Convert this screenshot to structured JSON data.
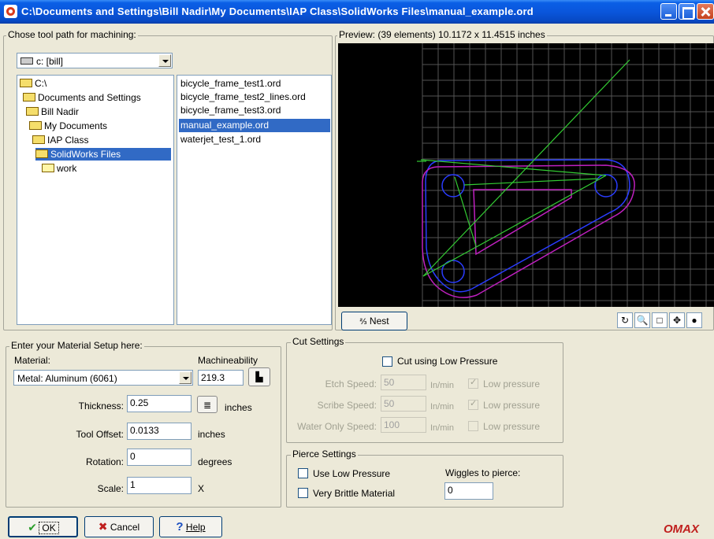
{
  "window": {
    "title": "C:\\Documents and Settings\\Bill Nadir\\My Documents\\IAP Class\\SolidWorks Files\\manual_example.ord"
  },
  "toolpath": {
    "group_label": "Chose tool path for machining:",
    "drive_value": "c: [bill]",
    "folders": [
      {
        "label": "C:\\",
        "open": true,
        "selected": false
      },
      {
        "label": "Documents and Settings",
        "open": true,
        "selected": false
      },
      {
        "label": "Bill Nadir",
        "open": true,
        "selected": false
      },
      {
        "label": "My Documents",
        "open": true,
        "selected": false
      },
      {
        "label": "IAP Class",
        "open": true,
        "selected": false
      },
      {
        "label": "SolidWorks Files",
        "open": true,
        "selected": true
      },
      {
        "label": "work",
        "open": false,
        "selected": false
      }
    ],
    "files": [
      {
        "label": "bicycle_frame_test1.ord",
        "selected": false
      },
      {
        "label": "bicycle_frame_test2_lines.ord",
        "selected": false
      },
      {
        "label": "bicycle_frame_test3.ord",
        "selected": false
      },
      {
        "label": "manual_example.ord",
        "selected": true
      },
      {
        "label": "waterjet_test_1.ord",
        "selected": false
      }
    ]
  },
  "preview": {
    "label": "Preview: (39 elements) 10.1172 x 11.4515 inches",
    "nest_label": "Nest",
    "colors": {
      "background": "#000000",
      "grid": "#555555",
      "part_outline": "#2a3cff",
      "cut_path": "#c020c0",
      "lead_lines": "#33cc33"
    },
    "tools": [
      "rotate-icon",
      "zoom-icon",
      "select-box-icon",
      "pan-icon",
      "globe-icon"
    ]
  },
  "material": {
    "group_label": "Enter your Material Setup here:",
    "material_label": "Material:",
    "material_value": "Metal: Aluminum (6061)",
    "machineability_label": "Machineability",
    "machineability_value": "219.3",
    "thickness_label": "Thickness:",
    "thickness_value": "0.25",
    "thickness_units": "inches",
    "tool_offset_label": "Tool Offset:",
    "tool_offset_value": "0.0133",
    "tool_offset_units": "inches",
    "rotation_label": "Rotation:",
    "rotation_value": "0",
    "rotation_units": "degrees",
    "scale_label": "Scale:",
    "scale_value": "1",
    "scale_units": "X"
  },
  "cut": {
    "group_label": "Cut Settings",
    "low_pressure_label": "Cut using Low Pressure",
    "etch_label": "Etch Speed:",
    "etch_value": "50",
    "scribe_label": "Scribe Speed:",
    "scribe_value": "50",
    "water_label": "Water Only Speed:",
    "water_value": "100",
    "units": "In/min",
    "lp_label": "Low pressure"
  },
  "pierce": {
    "group_label": "Pierce Settings",
    "use_low_label": "Use Low Pressure",
    "brittle_label": "Very Brittle Material",
    "wiggles_label": "Wiggles to pierce:",
    "wiggles_value": "0"
  },
  "buttons": {
    "ok": "OK",
    "cancel": "Cancel",
    "help": "Help"
  },
  "brand": "OMAX"
}
